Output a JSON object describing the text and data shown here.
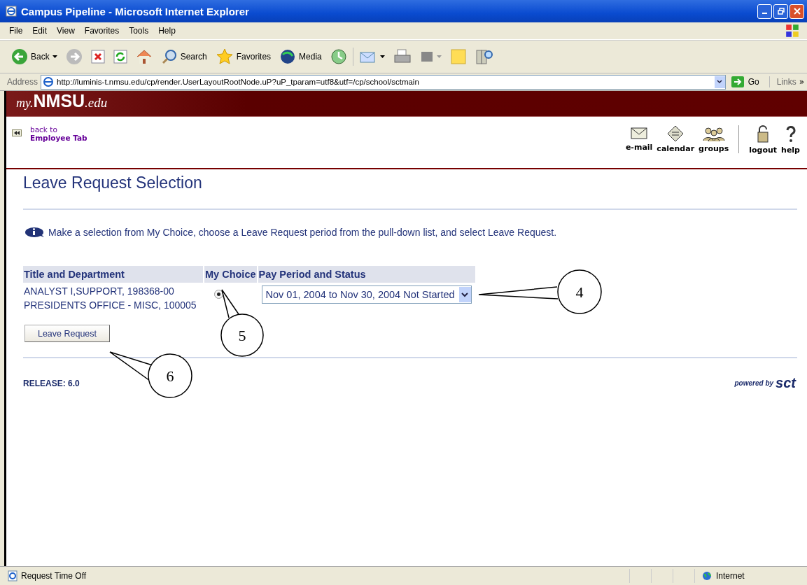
{
  "window": {
    "title": "Campus Pipeline - Microsoft Internet Explorer"
  },
  "menu": [
    "File",
    "Edit",
    "View",
    "Favorites",
    "Tools",
    "Help"
  ],
  "toolbar": [
    {
      "kind": "back",
      "label": "Back"
    },
    {
      "kind": "forward"
    },
    {
      "kind": "stop"
    },
    {
      "kind": "refresh"
    },
    {
      "kind": "home"
    },
    {
      "kind": "search",
      "label": "Search"
    },
    {
      "kind": "favorites",
      "label": "Favorites"
    },
    {
      "kind": "media",
      "label": "Media"
    },
    {
      "kind": "history"
    },
    {
      "kind": "mail"
    },
    {
      "kind": "print"
    },
    {
      "kind": "edit"
    },
    {
      "kind": "note"
    },
    {
      "kind": "research"
    }
  ],
  "address": {
    "label": "Address",
    "url": "http://luminis-t.nmsu.edu/cp/render.UserLayoutRootNode.uP?uP_tparam=utf8&utf=/cp/school/sctmain",
    "go": "Go",
    "links": "Links",
    "more": "»"
  },
  "banner": {
    "prefix": "my.",
    "name": "NMSU",
    ".suffix": ".edu"
  },
  "back_link": {
    "line1": "back to",
    "line2": "Employee Tab"
  },
  "nav": [
    {
      "kind": "mail",
      "label": "e-mail"
    },
    {
      "kind": "calendar",
      "label": "calendar"
    },
    {
      "kind": "groups",
      "label": "groups"
    },
    {
      "kind": "logout",
      "label": "logout"
    },
    {
      "kind": "help",
      "label": "help"
    }
  ],
  "page": {
    "title": "Leave Request Selection",
    "instruction": "Make a selection from My Choice, choose a Leave Request period from the pull-down list, and select Leave Request."
  },
  "table": {
    "columns": [
      "Title and Department",
      "My Choice",
      "Pay Period and Status"
    ],
    "rows": [
      {
        "title": [
          "ANALYST I,SUPPORT, 198368-00",
          "PRESIDENTS OFFICE - MISC, 100005"
        ],
        "selected": true,
        "period": "Nov 01, 2004 to Nov 30, 2004 Not Started"
      }
    ]
  },
  "button": "Leave Request",
  "release": "RELEASE: 6.0",
  "powered": {
    "text": "powered by",
    "logo": "sct"
  },
  "callouts": [
    "4",
    "5",
    "6"
  ],
  "status_bar": {
    "text": "Request Time Off",
    "zone": "Internet"
  }
}
